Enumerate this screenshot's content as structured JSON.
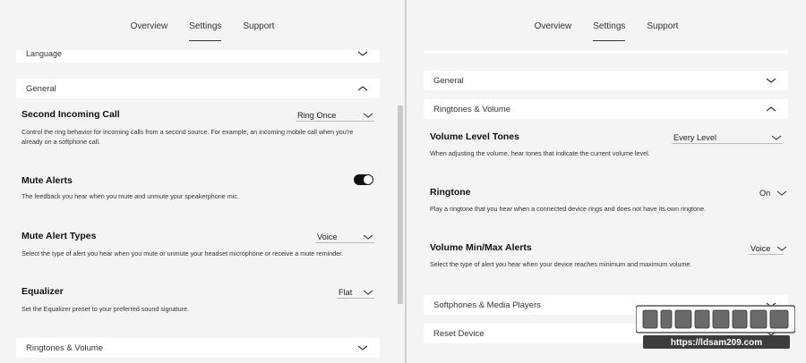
{
  "left": {
    "tabs": [
      "Overview",
      "Settings",
      "Support"
    ],
    "active_tab": "Settings",
    "cards": {
      "language": "Language",
      "general": "General",
      "ringtones": "Ringtones & Volume"
    },
    "settings": [
      {
        "title": "Second Incoming Call",
        "desc": "Control the ring behavior for incoming calls from a second source. For example, an incoming mobile call when you're already on a softphone call.",
        "value": "Ring Once"
      },
      {
        "title": "Mute Alerts",
        "desc": "The feedback you hear when you mute and unmute your speakerphone mic.",
        "toggle": "on"
      },
      {
        "title": "Mute Alert Types",
        "desc": "Select the type of alert you hear when you mute or unmute your headset microphone or receive a mute reminder.",
        "value": "Voice"
      },
      {
        "title": "Equalizer",
        "desc": "Set the Equalizer preset to your preferred sound signature.",
        "value": "Flat"
      }
    ]
  },
  "right": {
    "tabs": [
      "Overview",
      "Settings",
      "Support"
    ],
    "active_tab": "Settings",
    "cards": {
      "general": "General",
      "ringtones": "Ringtones & Volume",
      "softphones": "Softphones & Media Players",
      "reset": "Reset Device"
    },
    "settings": [
      {
        "title": "Volume Level Tones",
        "desc": "When adjusting the volume, hear tones that indicate the current volume level.",
        "value": "Every Level"
      },
      {
        "title": "Ringtone",
        "desc": "Play a ringtone that you hear when a connected device rings and does not have its own ringtone.",
        "value": "On"
      },
      {
        "title": "Volume Min/Max Alerts",
        "desc": "Select the type of alert you hear when your device reaches minimum and maximum volume.",
        "value": "Voice"
      }
    ]
  },
  "watermark": {
    "text": "https://ldsam209.com"
  },
  "colors": {
    "background": "#f4f4f4",
    "card": "#ffffff",
    "toggle_on": "#111111"
  }
}
